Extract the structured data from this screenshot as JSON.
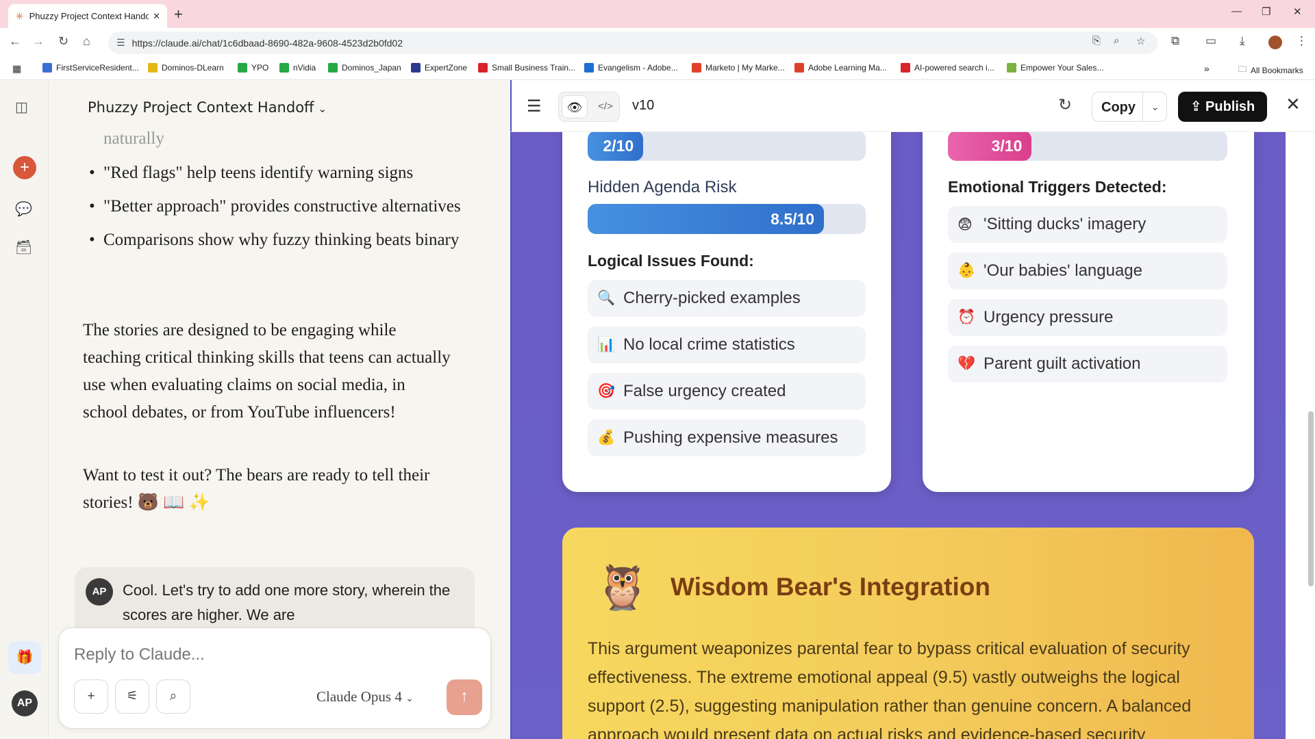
{
  "browser": {
    "tab_title": "Phuzzy Project Context Handoff",
    "url": "https://claude.ai/chat/1c6dbaad-8690-482a-9608-4523d2b0fd02",
    "bookmarks": [
      {
        "label": "FirstServiceResident...",
        "color": "#3b6fd4"
      },
      {
        "label": "Dominos-DLearn",
        "color": "#e3b818"
      },
      {
        "label": "YPO",
        "color": "#27a745"
      },
      {
        "label": "nVidia",
        "color": "#27a745"
      },
      {
        "label": "Dominos_Japan",
        "color": "#27a745"
      },
      {
        "label": "ExpertZone",
        "color": "#2b3a8f"
      },
      {
        "label": "Small Business Train...",
        "color": "#d9232d"
      },
      {
        "label": "Evangelism - Adobe...",
        "color": "#1d6fd1"
      },
      {
        "label": "Marketo | My Marke...",
        "color": "#e0402b"
      },
      {
        "label": "Adobe Learning Ma...",
        "color": "#e0402b"
      },
      {
        "label": "AI-powered search i...",
        "color": "#d9232d"
      },
      {
        "label": "Empower Your Sales...",
        "color": "#7bb342"
      }
    ],
    "all_bookmarks": "All Bookmarks"
  },
  "chat": {
    "title": "Phuzzy Project Context Handoff",
    "faded_line": "naturally",
    "bullets": [
      "\"Red flags\" help teens identify warning signs",
      "\"Better approach\" provides constructive alternatives",
      "Comparisons show why fuzzy thinking beats binary"
    ],
    "para1": "The stories are designed to be engaging while teaching critical thinking skills that teens can actually use when evaluating claims on social media, in school debates, or from YouTube influencers!",
    "para2": "Want to test it out? The bears are ready to tell their stories! 🐻 📖 ✨",
    "user_initials": "AP",
    "user_message": "Cool. Let's try to add one more story, wherein the scores are higher.  We are",
    "composer_placeholder": "Reply to Claude...",
    "model_name": "Claude",
    "model_version": "Opus 4"
  },
  "artifact": {
    "version": "v10",
    "copy_label": "Copy",
    "publish_label": "Publish",
    "left_card": {
      "top_score_label": "2/10",
      "top_score_value": 0.2,
      "hidden_agenda_label": "Hidden Agenda Risk",
      "hidden_agenda_score": "8.5/10",
      "hidden_agenda_value": 0.85,
      "issues_heading": "Logical Issues Found:",
      "issues": [
        {
          "emoji": "🔍",
          "text": "Cherry-picked examples"
        },
        {
          "emoji": "📊",
          "text": "No local crime statistics"
        },
        {
          "emoji": "🎯",
          "text": "False urgency created"
        },
        {
          "emoji": "💰",
          "text": "Pushing expensive measures"
        }
      ]
    },
    "right_card": {
      "top_score_label": "3/10",
      "top_score_value": 0.3,
      "triggers_heading": "Emotional Triggers Detected:",
      "triggers": [
        {
          "emoji": "😨",
          "text": "'Sitting ducks' imagery"
        },
        {
          "emoji": "👶",
          "text": "'Our babies' language"
        },
        {
          "emoji": "⏰",
          "text": "Urgency pressure"
        },
        {
          "emoji": "💔",
          "text": "Parent guilt activation"
        }
      ]
    },
    "wisdom": {
      "emoji": "🦉",
      "title": "Wisdom Bear's Integration",
      "text": "This argument weaponizes parental fear to bypass critical evaluation of security effectiveness. The extreme emotional appeal (9.5) vastly outweighs the logical support (2.5), suggesting manipulation rather than genuine concern. A balanced approach would present data on actual risks and evidence-based security"
    }
  }
}
